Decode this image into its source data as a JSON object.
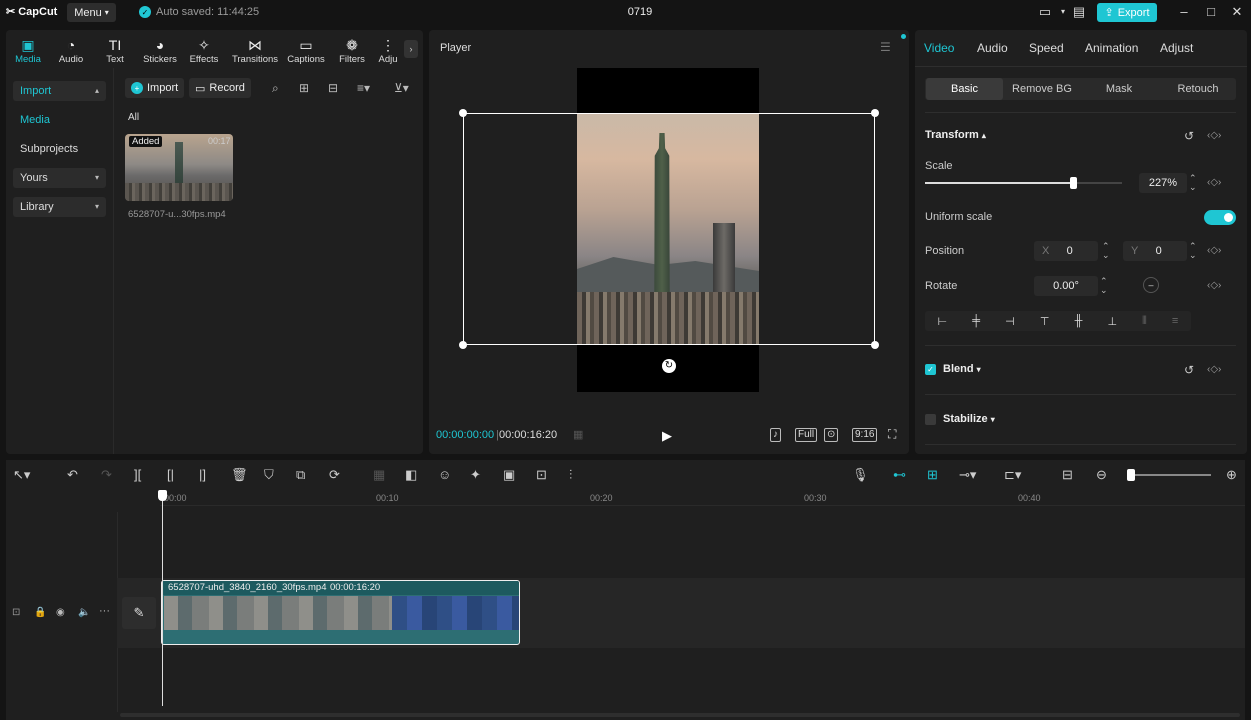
{
  "app": {
    "logo": "CapCut",
    "menu_label": "Menu",
    "autosave": "Auto saved: 11:44:25",
    "project_name": "0719",
    "export_label": "Export",
    "accent": "#1fc6d3"
  },
  "media_tabs": [
    {
      "label": "Media",
      "icon": "media-icon"
    },
    {
      "label": "Audio",
      "icon": "audio-icon"
    },
    {
      "label": "Text",
      "icon": "text-icon"
    },
    {
      "label": "Stickers",
      "icon": "stickers-icon"
    },
    {
      "label": "Effects",
      "icon": "effects-icon"
    },
    {
      "label": "Transitions",
      "icon": "transitions-icon"
    },
    {
      "label": "Captions",
      "icon": "captions-icon"
    },
    {
      "label": "Filters",
      "icon": "filters-icon"
    },
    {
      "label": "Adju",
      "icon": "adjust-icon"
    }
  ],
  "sidebar": {
    "import": "Import",
    "media": "Media",
    "subprojects": "Subprojects",
    "yours": "Yours",
    "library": "Library"
  },
  "media": {
    "import_btn": "Import",
    "record_btn": "Record",
    "filter_all": "All",
    "clip": {
      "badge": "Added",
      "duration": "00:17",
      "name": "6528707-u...30fps.mp4"
    }
  },
  "player": {
    "title": "Player",
    "time_current": "00:00:00:00",
    "time_total": "00:00:16:20",
    "full": "Full",
    "ratio": "9:16"
  },
  "props": {
    "tabs": [
      "Video",
      "Audio",
      "Speed",
      "Animation",
      "Adjust"
    ],
    "subtabs": [
      "Basic",
      "Remove BG",
      "Mask",
      "Retouch"
    ],
    "transform": "Transform",
    "scale_label": "Scale",
    "scale_value": "227%",
    "scale_fraction": 0.75,
    "uniform_scale": "Uniform scale",
    "position_label": "Position",
    "pos_x_label": "X",
    "pos_x": "0",
    "pos_y_label": "Y",
    "pos_y": "0",
    "rotate_label": "Rotate",
    "rotate_value": "0.00°",
    "blend": "Blend",
    "stabilize": "Stabilize"
  },
  "timeline": {
    "ticks": [
      "00:00",
      "00:10",
      "00:20",
      "00:30",
      "00:40"
    ],
    "clip_name": "6528707-uhd_3840_2160_30fps.mp4",
    "clip_duration": "00:00:16:20"
  }
}
